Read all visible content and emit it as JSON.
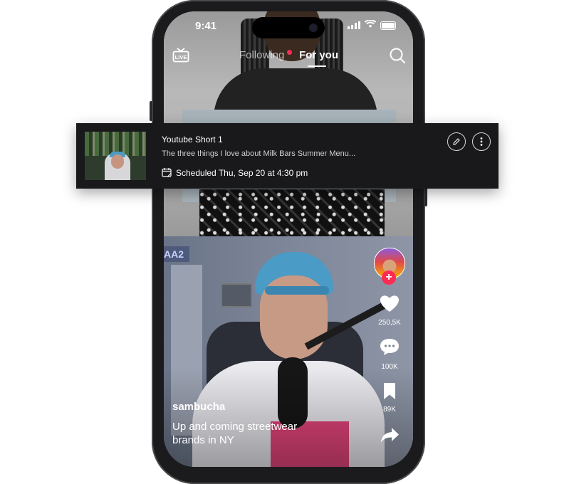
{
  "status_bar": {
    "time": "9:41"
  },
  "top_nav": {
    "tab_following": "Following",
    "tab_for_you": "For you"
  },
  "schedule_card": {
    "title": "Youtube Short 1",
    "description": "The three things I love about Milk Bars Summer Menu...",
    "scheduled": "Scheduled Thu, Sep 20 at 4:30 pm"
  },
  "video": {
    "username": "sambucha",
    "caption": "Up and coming streetwear brands in NY"
  },
  "actions": {
    "likes": "250,5K",
    "comments": "100K",
    "saves": "89K"
  },
  "colors": {
    "accent": "#fe2c55",
    "card_bg": "#19191b",
    "phone_frame": "#1b1b1d"
  }
}
